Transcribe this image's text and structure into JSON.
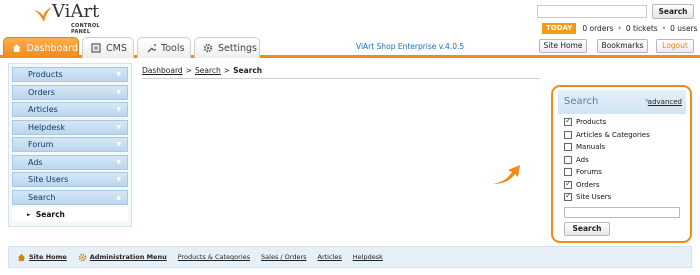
{
  "header": {
    "logo_title": "ViArt",
    "logo_subtitle": "CONTROL PANEL",
    "search_button": "Search",
    "today_badge": "TODAY",
    "orders_stat": "0 orders",
    "tickets_stat": "0 tickets",
    "users_stat": "0 users",
    "separator": "•"
  },
  "tabs": [
    {
      "label": "Dashboard",
      "icon": "house-icon",
      "active": true
    },
    {
      "label": "CMS",
      "icon": "document-icon",
      "active": false
    },
    {
      "label": "Tools",
      "icon": "wrench-icon",
      "active": false
    },
    {
      "label": "Settings",
      "icon": "gear-icon",
      "active": false
    }
  ],
  "version": "ViArt Shop Enterprise v.4.0.5",
  "header_buttons": {
    "site_home": "Site Home",
    "bookmarks": "Bookmarks",
    "logout": "Logout"
  },
  "sidebar": {
    "items": [
      {
        "label": "Products"
      },
      {
        "label": "Orders"
      },
      {
        "label": "Articles"
      },
      {
        "label": "Helpdesk"
      },
      {
        "label": "Forum"
      },
      {
        "label": "Ads"
      },
      {
        "label": "Site Users"
      },
      {
        "label": "Search"
      }
    ],
    "sub_item": "Search"
  },
  "breadcrumb": {
    "crumb1": "Dashboard",
    "crumb2": "Search",
    "current": "Search",
    "sep": ">"
  },
  "search_panel": {
    "title": "Search",
    "advanced_link": "advanced",
    "options": [
      {
        "label": "Products",
        "checked": true
      },
      {
        "label": "Articles & Categories",
        "checked": false
      },
      {
        "label": "Manuals",
        "checked": false
      },
      {
        "label": "Ads",
        "checked": false
      },
      {
        "label": "Forums",
        "checked": false
      },
      {
        "label": "Orders",
        "checked": true
      },
      {
        "label": "Site Users",
        "checked": true
      }
    ],
    "button": "Search"
  },
  "footer": {
    "site_home": "Site Home",
    "admin_menu": "Administration Menu",
    "links": [
      "Products & Categories",
      "Sales / Orders",
      "Articles",
      "Helpdesk"
    ]
  },
  "colors": {
    "accent": "#f18a17",
    "link_blue": "#1e6fc0",
    "sidebar_blue": "#bcd6ec"
  }
}
